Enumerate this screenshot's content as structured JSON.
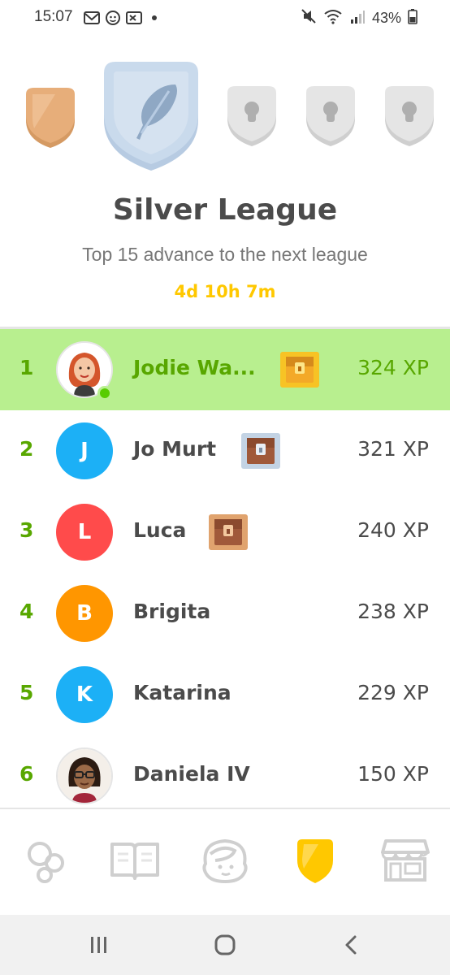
{
  "status_bar": {
    "time": "15:07",
    "battery": "43%",
    "icons_left": [
      "gmail-icon",
      "snapchat-icon",
      "cs-icon",
      "dot-icon"
    ],
    "icons_right": [
      "mute-icon",
      "wifi-icon",
      "signal-icon",
      "battery-icon"
    ]
  },
  "league": {
    "badges": [
      "bronze",
      "silver",
      "locked",
      "locked",
      "locked"
    ],
    "current_badge": "silver",
    "title": "Silver League",
    "subtitle": "Top 15 advance to the next league",
    "timer": "4d 10h 7m"
  },
  "leaderboard": [
    {
      "rank": "1",
      "name": "Jodie Wa...",
      "xp": "324 XP",
      "avatar": "photo",
      "avatar_letter": "",
      "avatar_color": "#ffffff",
      "chest": "gold",
      "current_user": true,
      "online": true
    },
    {
      "rank": "2",
      "name": "Jo Murt",
      "xp": "321 XP",
      "avatar": "letter",
      "avatar_letter": "J",
      "avatar_color": "#1cb0f6",
      "chest": "silver",
      "current_user": false
    },
    {
      "rank": "3",
      "name": "Luca",
      "xp": "240 XP",
      "avatar": "letter",
      "avatar_letter": "L",
      "avatar_color": "#ff4b4b",
      "chest": "bronze",
      "current_user": false
    },
    {
      "rank": "4",
      "name": "Brigita",
      "xp": "238 XP",
      "avatar": "letter",
      "avatar_letter": "B",
      "avatar_color": "#ff9600",
      "chest": "none",
      "current_user": false
    },
    {
      "rank": "5",
      "name": "Katarina",
      "xp": "229 XP",
      "avatar": "letter",
      "avatar_letter": "K",
      "avatar_color": "#1cb0f6",
      "chest": "none",
      "current_user": false
    },
    {
      "rank": "6",
      "name": "Daniela IV",
      "xp": "150 XP",
      "avatar": "photo",
      "avatar_letter": "",
      "avatar_color": "#ffffff",
      "chest": "none",
      "current_user": false
    }
  ],
  "bottom_nav": {
    "items": [
      "learn-icon",
      "stories-icon",
      "profile-icon",
      "leaderboard-icon",
      "shop-icon"
    ],
    "active": "leaderboard-icon"
  },
  "system_nav": [
    "recents-icon",
    "home-icon",
    "back-icon"
  ],
  "colors": {
    "green": "#58a700",
    "highlight": "#b8ef8f",
    "gold": "#ffc800",
    "text": "#4b4b4b",
    "muted": "#777777"
  }
}
